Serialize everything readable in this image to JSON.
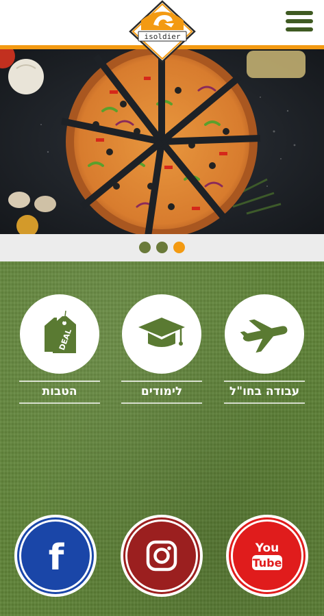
{
  "header": {
    "logo_text": "isoldier",
    "menu_icon": "hamburger-icon"
  },
  "hero": {
    "image": "pizza-slices-photo",
    "slides_count": 3,
    "active_slide": 3
  },
  "categories": [
    {
      "label": "עבודה בחו\"ל",
      "icon": "airplane-icon"
    },
    {
      "label": "לימודים",
      "icon": "graduation-cap-icon"
    },
    {
      "label": "הטבות",
      "icon": "deal-tag-icon",
      "icon_text": "DEAL"
    }
  ],
  "social": [
    {
      "name": "youtube",
      "color": "#e01c1c",
      "icon": "youtube-icon",
      "icon_text_top": "You",
      "icon_text_bottom": "Tube"
    },
    {
      "name": "instagram",
      "color": "#9b1f1f",
      "icon": "instagram-icon"
    },
    {
      "name": "facebook",
      "color": "#1a46a8",
      "icon": "facebook-icon",
      "icon_text": "f"
    }
  ],
  "colors": {
    "accent_orange": "#f39a12",
    "dark_green": "#3f5a22",
    "field_green": "#5f8338",
    "icon_green": "#5a7a32"
  }
}
